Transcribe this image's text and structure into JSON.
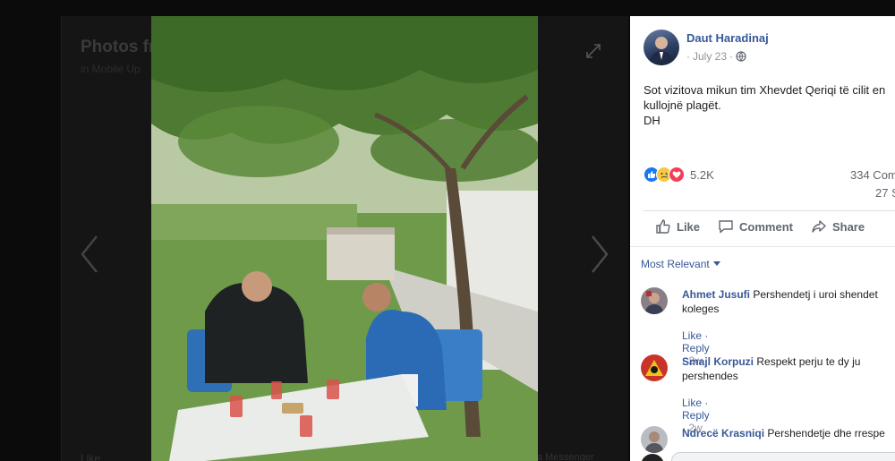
{
  "background": {
    "title": "Photos fr",
    "subtitle": "in Mobile Up",
    "bottom_left": "Like",
    "bottom_right": "a Messenger"
  },
  "post": {
    "author": "Daut Haradinaj",
    "date": "July 23",
    "privacy_icon": "globe-icon",
    "text": "Sot vizitova mikun tim Xhevdet Qeriqi të cilit en\nkullojnë plagët.\nDH",
    "reactions_count": "5.2K",
    "comments_count": "334 Com",
    "shares_count": "27 S"
  },
  "actions": {
    "like": "Like",
    "comment": "Comment",
    "share": "Share"
  },
  "comments_filter": "Most Relevant",
  "comments": [
    {
      "name": "Ahmet Jusufi",
      "text": "Pershendetj i uroi shendet koleges",
      "like": "Like",
      "reply": "Reply",
      "time": "2w"
    },
    {
      "name": "Smajl Korpuzi",
      "text": "Respekt perju te dy ju pershendes",
      "like": "Like",
      "reply": "Reply",
      "time": "2w"
    },
    {
      "name": "Ndrecë Krasniqi",
      "text": "Pershendetje dhe rrespe"
    }
  ],
  "colors": {
    "link": "#385898",
    "like_blue": "#1877f2",
    "love_red": "#f33e58",
    "sad_yellow": "#f7c946"
  }
}
